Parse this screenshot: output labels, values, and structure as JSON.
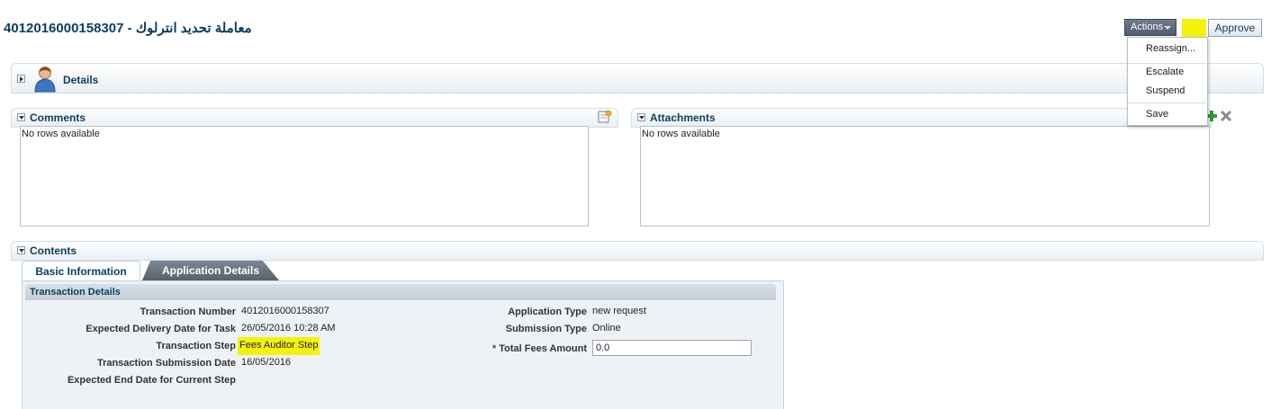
{
  "header": {
    "title": "4012016000158307 - معاملة تحديد انترلوك",
    "actions_label": "Actions",
    "approve_label": "Approve"
  },
  "actions_menu": {
    "items": [
      "Reassign...",
      "Escalate",
      "Suspend",
      "Save"
    ]
  },
  "details": {
    "label": "Details"
  },
  "comments": {
    "label": "Comments",
    "empty_text": "No rows available"
  },
  "attachments": {
    "label": "Attachments",
    "empty_text": "No rows available"
  },
  "contents": {
    "label": "Contents",
    "tabs": [
      "Basic Information",
      "Application Details"
    ],
    "section_title": "Transaction Details",
    "left_fields": [
      {
        "label": "Transaction Number",
        "value": "4012016000158307"
      },
      {
        "label": "Expected Delivery Date for Task",
        "value": "26/05/2016 10:28 AM"
      },
      {
        "label": "Transaction Step",
        "value": "Fees Auditor Step"
      },
      {
        "label": "Transaction Submission Date",
        "value": "16/05/2016"
      },
      {
        "label": "Expected End Date for Current Step",
        "value": ""
      }
    ],
    "right_fields": [
      {
        "label": "Application Type",
        "value": "new request"
      },
      {
        "label": "Submission Type",
        "value": "Online"
      },
      {
        "label": "Total Fees Amount",
        "value": "0.0",
        "required_mark": "*"
      }
    ]
  },
  "colors": {
    "title": "#0b3d5e",
    "highlight": "#f4f20a",
    "actions_button": "#5a6775",
    "add_icon": "#2e9b2e",
    "delete_icon": "#8c8c8c"
  }
}
